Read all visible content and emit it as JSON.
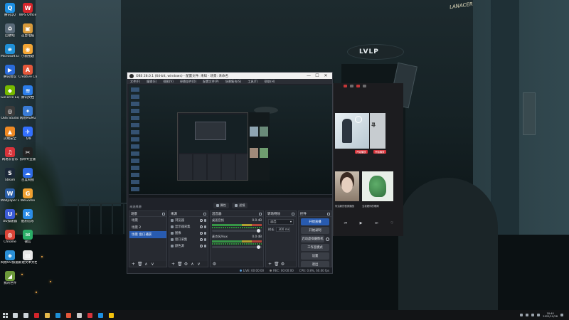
{
  "desktop": {
    "icons": [
      {
        "label": "腾讯QQ",
        "glyph": "Q",
        "color": "#1d8fe1"
      },
      {
        "label": "WPS Office",
        "glyph": "W",
        "color": "#d6252b"
      },
      {
        "label": "回收站",
        "glyph": "♻",
        "color": "#5a6a78"
      },
      {
        "label": "这台电脑",
        "glyph": "▣",
        "color": "#d89a3a"
      },
      {
        "label": "Microsoft Edge",
        "glyph": "e",
        "color": "#1f8fd6"
      },
      {
        "label": "小猿搜题",
        "glyph": "◉",
        "color": "#f2a534"
      },
      {
        "label": "腾讯会议",
        "glyph": "▶",
        "color": "#2a6bd9"
      },
      {
        "label": "Creative Cloud",
        "glyph": "A",
        "color": "#e3573a"
      },
      {
        "label": "GeForce Experience",
        "glyph": "◆",
        "color": "#76b900"
      },
      {
        "label": "腾讯文档",
        "glyph": "≋",
        "color": "#2b7de9"
      },
      {
        "label": "OBS Studio",
        "glyph": "◎",
        "color": "#3b3b3b"
      },
      {
        "label": "网易MuMu",
        "glyph": "✦",
        "color": "#3a7bd5"
      },
      {
        "label": "火绒安全",
        "glyph": "▲",
        "color": "#f08a24"
      },
      {
        "label": "飞书",
        "glyph": "✈",
        "color": "#3370ff"
      },
      {
        "label": "网易云音乐",
        "glyph": "♫",
        "color": "#d7343b"
      },
      {
        "label": "剪映专业版",
        "glyph": "✂",
        "color": "#222222"
      },
      {
        "label": "Steam",
        "glyph": "S",
        "color": "#1b2838"
      },
      {
        "label": "百度网盘",
        "glyph": "☁",
        "color": "#2e6be6"
      },
      {
        "label": "Wallpaper Engine",
        "glyph": "W",
        "color": "#2a5ea8"
      },
      {
        "label": "WeGame",
        "glyph": "G",
        "color": "#f0a030"
      },
      {
        "label": "UU加速器",
        "glyph": "U",
        "color": "#3b5bd6"
      },
      {
        "label": "酷狗音乐",
        "glyph": "K",
        "color": "#2b8de8"
      },
      {
        "label": "Chrome",
        "glyph": "◍",
        "color": "#db4437"
      },
      {
        "label": "微信",
        "glyph": "✉",
        "color": "#2aae67"
      },
      {
        "label": "网易UU加速器",
        "glyph": "◈",
        "color": "#2a8fd6"
      },
      {
        "label": "新建文本文档",
        "glyph": "▤",
        "color": "#e8e8e8"
      },
      {
        "label": "我的世界",
        "glyph": "◢",
        "color": "#6c9a3a"
      }
    ]
  },
  "wallpaper": {
    "tower_sign": "LVLP",
    "signature": "LANACER"
  },
  "obs": {
    "title": "OBS 28.0.1 (64-bit, windows) - 配置文件: 未知 - 场景: 未命名",
    "window_controls": [
      "—",
      "☐",
      "✕"
    ],
    "menu": [
      "文件(F)",
      "编辑(E)",
      "视图(V)",
      "停靠部件(D)",
      "配置文件(P)",
      "场景集合(S)",
      "工具(T)",
      "帮助(H)"
    ],
    "source_label": "未选择源",
    "toolbar": [
      {
        "label": "属性",
        "icon": "gear-icon"
      },
      {
        "label": "滤镜",
        "icon": "filter-icon"
      }
    ],
    "docks": {
      "scenes": {
        "title": "场景",
        "items": [
          "场景",
          "场景 2",
          "场景 窗口捕获"
        ],
        "selected_index": 2
      },
      "sources": {
        "title": "来源",
        "items": [
          "浏览器",
          "显示器采集",
          "图像",
          "窗口采集",
          "颜色源"
        ]
      },
      "mixer": {
        "title": "混音器",
        "channels": [
          {
            "name": "桌面音频",
            "db": "0.0 dB",
            "level": 0.85
          },
          {
            "name": "麦克风/Aux",
            "db": "0.0 dB",
            "level": 0.85
          }
        ]
      },
      "transitions": {
        "title": "转场特效",
        "selected": "淡出",
        "duration_label": "时长",
        "duration": "300 ms"
      },
      "controls": {
        "title": "控件",
        "buttons": [
          "开始直播",
          "开始录制",
          "启动虚拟摄像机",
          "工作室模式",
          "设置",
          "退出"
        ]
      }
    },
    "footer_symbols": [
      "+",
      "🗑",
      "⚙",
      "∧",
      "∨"
    ],
    "status": {
      "live": "LIVE: 00:00:00",
      "rec": "REC: 00:00:00",
      "cpu": "CPU: 0.8%, 60.00 fps"
    }
  },
  "music": {
    "card_text": "寻",
    "badge1": "开始播放",
    "badge2": "开始播放",
    "caption1": "何洁新的音频播放",
    "caption2": "当我看你的眼睛"
  },
  "taskbar": {
    "time": "18:40",
    "date": "2022/10/28",
    "apps": [
      {
        "icon": "search-icon",
        "color": "#cfd4d9"
      },
      {
        "icon": "taskview-icon",
        "color": "#cfd4d9"
      },
      {
        "icon": "wps-icon",
        "color": "#d6252b"
      },
      {
        "icon": "explorer-icon",
        "color": "#e7b84a"
      },
      {
        "icon": "edge-icon",
        "color": "#1f8fd6"
      },
      {
        "icon": "creative-cloud-icon",
        "color": "#e3573a"
      },
      {
        "icon": "obs-icon",
        "color": "#cccccc"
      },
      {
        "icon": "netease-music-icon",
        "color": "#d7343b"
      },
      {
        "icon": "qq-icon",
        "color": "#1d8fe1"
      },
      {
        "icon": "chrome-icon",
        "color": "#f4c20d"
      }
    ]
  }
}
